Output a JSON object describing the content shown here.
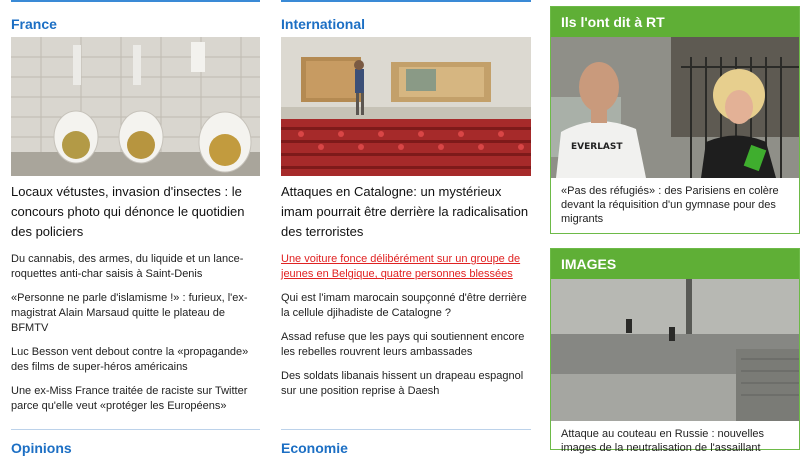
{
  "france": {
    "title": "France",
    "lead": "Locaux vétustes, invasion d'insectes : le concours photo qui dénonce le quotidien des policiers",
    "items": [
      "Du cannabis, des armes, du liquide et un lance-roquettes anti-char saisis à Saint-Denis",
      "«Personne ne parle d'islamisme !» : furieux, l'ex-magistrat Alain Marsaud quitte le plateau de BFMTV",
      "Luc Besson vent debout contre la «propagande» des films de super-héros américains",
      "Une ex-Miss France traitée de raciste sur Twitter parce qu'elle veut «protéger les Européens»"
    ]
  },
  "international": {
    "title": "International",
    "lead": "Attaques en Catalogne: un mystérieux imam pourrait être derrière la radicalisation des terroristes",
    "items": [
      "Une voiture fonce délibérément sur un groupe de jeunes en Belgique, quatre personnes blessées",
      "Qui est l'imam marocain soupçonné d'être derrière la cellule djihadiste de Catalogne ?",
      "Assad refuse que les pays qui soutiennent encore les rebelles rouvrent leurs ambassades",
      "Des soldats libanais hissent un drapeau espagnol sur une position reprise à Daesh"
    ]
  },
  "rt_said": {
    "title": "Ils l'ont dit à RT",
    "caption": "«Pas des réfugiés» : des Parisiens en colère devant la réquisition d'un gymnase pour des migrants"
  },
  "images": {
    "title": "IMAGES",
    "caption": "Attaque au couteau en Russie : nouvelles images de la neutralisation de l'assaillant"
  },
  "bottom": {
    "opinions": "Opinions",
    "economie": "Economie"
  },
  "colors": {
    "section_blue": "#1c6fc4",
    "rt_green": "#5faf36",
    "link_red": "#e02222"
  }
}
